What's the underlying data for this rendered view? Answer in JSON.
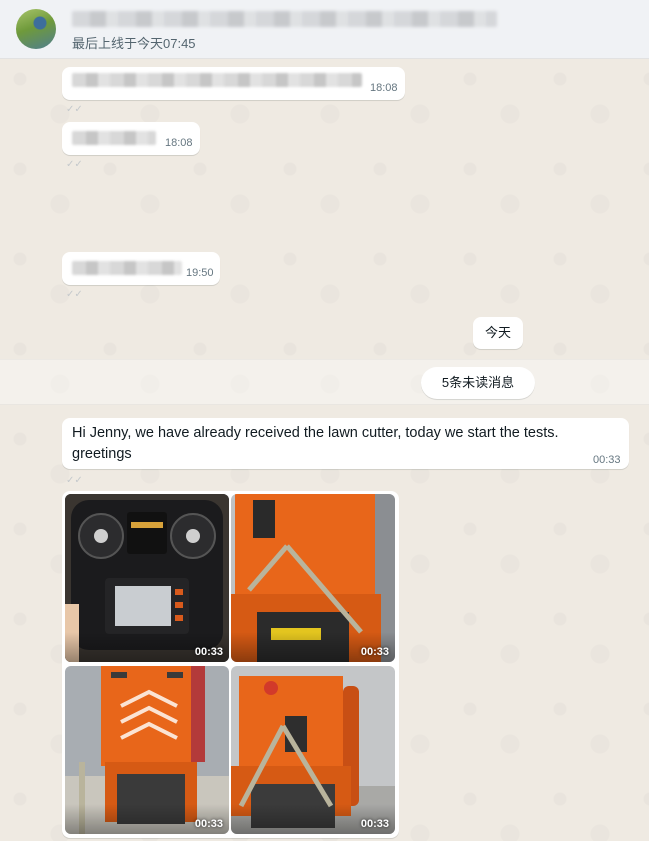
{
  "header": {
    "last_seen": "最后上线于今天07:45"
  },
  "messages": {
    "m1_time": "18:08",
    "m2_time": "18:08",
    "m3_time": "19:50",
    "date_separator": "今天",
    "unread_label": "5条未读消息",
    "m4_line1": "Hi Jenny, we have already received the lawn cutter, today we start the tests.",
    "m4_line2": "greetings",
    "m4_time": "00:33"
  },
  "media": [
    {
      "duration": "00:33",
      "subject": "remote-controller"
    },
    {
      "duration": "00:33",
      "subject": "orange-machine-front"
    },
    {
      "duration": "00:33",
      "subject": "orange-machine-rear"
    },
    {
      "duration": "00:33",
      "subject": "orange-machine-side"
    }
  ],
  "colors": {
    "header_bg": "#f0f2f5",
    "chat_bg": "#efeae2",
    "bubble_bg": "#ffffff",
    "accent_orange": "#e8661a"
  }
}
